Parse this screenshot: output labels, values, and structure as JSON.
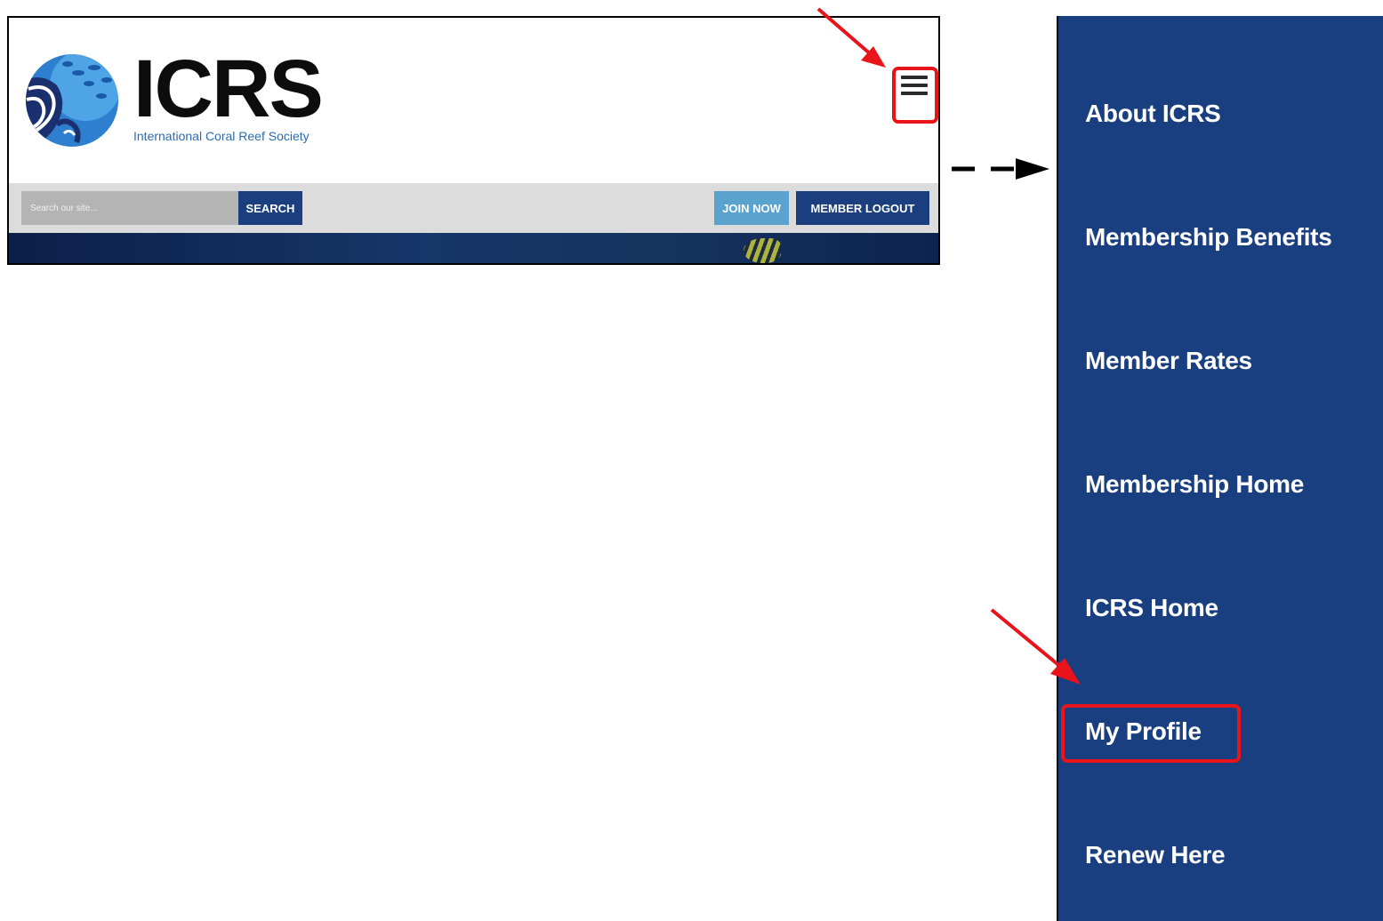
{
  "site": {
    "logo_text": "ICRS",
    "logo_subtitle": "International Coral Reef Society",
    "search": {
      "placeholder": "Search our site...",
      "button_label": "SEARCH"
    },
    "join_label": "JOIN NOW",
    "logout_label": "MEMBER LOGOUT"
  },
  "menu": {
    "items": [
      {
        "label": "About ICRS"
      },
      {
        "label": "Membership Benefits"
      },
      {
        "label": "Member Rates"
      },
      {
        "label": "Membership Home"
      },
      {
        "label": "ICRS Home"
      },
      {
        "label": "My Profile"
      },
      {
        "label": "Renew Here"
      }
    ]
  },
  "colors": {
    "brand_navy": "#1b3f7e",
    "accent_light_blue": "#5aa3cf",
    "annotation_red": "#e8141a"
  }
}
